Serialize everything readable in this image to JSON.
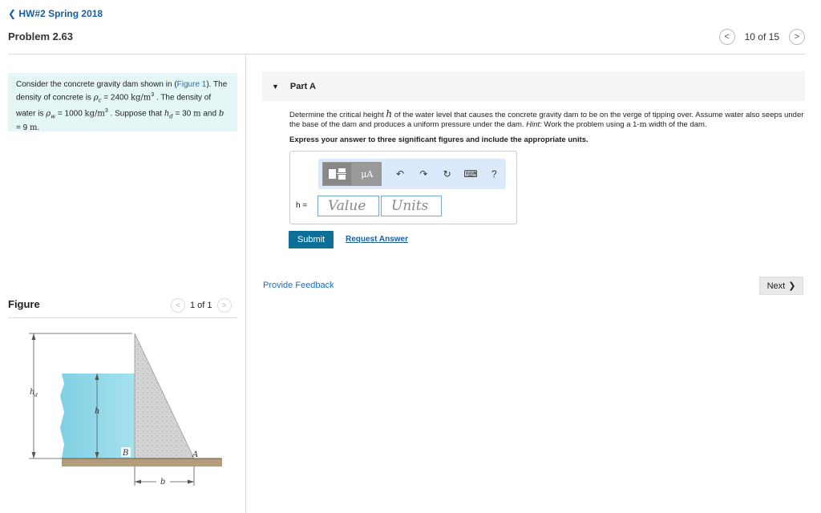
{
  "header": {
    "back_label": "HW#2 Spring 2018",
    "back_icon": "chevron-left-icon",
    "problem_title": "Problem 2.63",
    "pager_text": "10 of 15"
  },
  "intro": {
    "text1": "Consider the concrete gravity dam shown in (",
    "figure_link": "Figure 1",
    "text2": "). The density of concrete is ",
    "rho_c_symbol": "ρ",
    "rho_c_sub": "c",
    "text3": " = 2400 ",
    "unit_kg_m3_a": "kg/m",
    "text4": " . The density of water is ",
    "rho_w_symbol": "ρ",
    "rho_w_sub": "w",
    "text5": " = 1000 ",
    "unit_kg_m3_b": "kg/m",
    "text6": " . Suppose that ",
    "hd_symbol": "h",
    "hd_sub": "d",
    "text7": " = 30 ",
    "unit_m_a": "m",
    "text8": " and ",
    "b_symbol": "b",
    "text9": " = 9 ",
    "unit_m_b": "m",
    "text10": ".",
    "exp": "3"
  },
  "figure": {
    "title": "Figure",
    "pager_text": "1 of 1",
    "labels": {
      "hd": "h",
      "hd_sub": "d",
      "h": "h",
      "B": "B",
      "A": "A",
      "b": "b"
    },
    "colors": {
      "water": "#8fd7e6",
      "concrete": "#d3d3d3",
      "ground": "#b09a7a"
    }
  },
  "part": {
    "label": "Part A",
    "question_1": "Determine the critical height ",
    "question_h": "h",
    "question_2": " of the water level that causes the concrete gravity dam to be on the verge of tipping over. Assume water also seeps under the base of the dam and produces a uniform pressure under the dam. ",
    "question_hint": "Hint:",
    "question_3": " Work the problem using a 1-",
    "question_m": "m",
    "question_4": " width of the dam.",
    "instructions": "Express your answer to three significant figures and include the appropriate units.",
    "answer_label": "h =",
    "value_placeholder": "Value",
    "units_placeholder": "Units",
    "toolbar": {
      "mu_label": "μA",
      "help_label": "?"
    },
    "submit_label": "Submit",
    "request_label": "Request Answer"
  },
  "footer": {
    "feedback_label": "Provide Feedback",
    "next_label": "Next"
  }
}
